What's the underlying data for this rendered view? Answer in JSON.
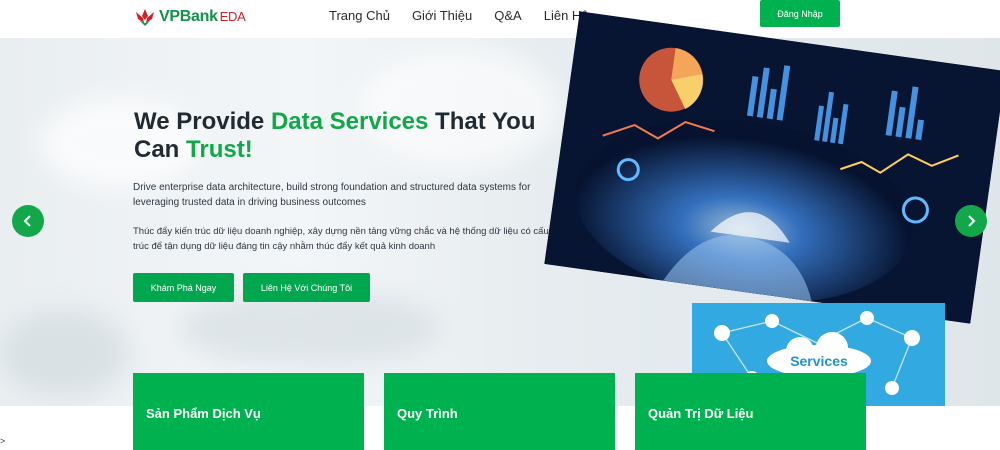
{
  "header": {
    "logo_brand": "VPBank",
    "logo_suffix": "EDA",
    "nav": [
      "Trang Chủ",
      "Giới Thiệu",
      "Q&A",
      "Liên Hệ"
    ],
    "login_label": "Đăng Nhập"
  },
  "hero": {
    "title_part1": "We Provide ",
    "title_highlight1": "Data Services",
    "title_part2": " That You Can ",
    "title_highlight2": "Trust!",
    "desc_en": "Drive enterprise data architecture, build strong foundation and structured data systems for leveraging trusted data in driving business outcomes",
    "desc_vi": "Thúc đẩy kiến trúc dữ liệu doanh nghiệp, xây dựng nền tảng vững chắc và hệ thống dữ liệu có cấu trúc để tận dụng dữ liệu đáng tin cậy nhằm thúc đẩy kết quả kinh doanh",
    "btn_explore": "Khám Phá Ngay",
    "btn_contact": "Liên Hệ Với Chúng Tôi",
    "services_label": "Services"
  },
  "cards": [
    {
      "title": "Sản Phẩm Dịch Vụ"
    },
    {
      "title": "Quy Trình"
    },
    {
      "title": "Quản Trị Dữ Liệu"
    }
  ],
  "icons": {
    "prev": "chevron-left-icon",
    "next": "chevron-right-icon",
    "logo": "lotus-logo-icon"
  },
  "colors": {
    "brand_green": "#00b14f",
    "brand_red": "#d0212a"
  },
  "corner_text": ">"
}
